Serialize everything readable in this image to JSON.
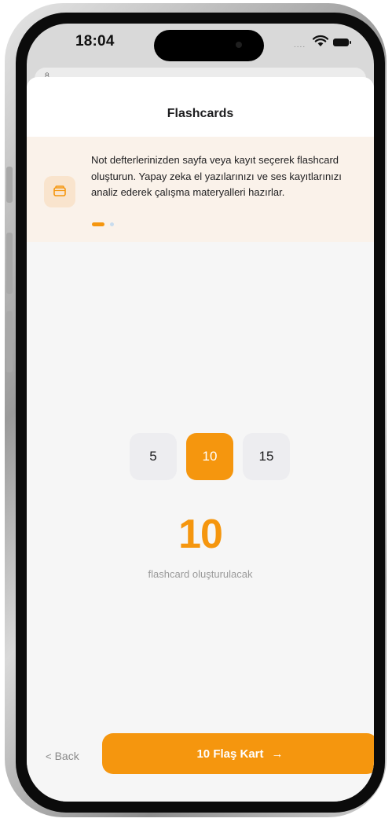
{
  "status_bar": {
    "time": "18:04",
    "signal": "...."
  },
  "sheet": {
    "title": "Flashcards",
    "back_sheet_mark": "৪"
  },
  "banner": {
    "text": "Not defterlerinizden sayfa veya kayıt seçerek flashcard oluşturun. Yapay zeka el yazılarınızı ve ses kayıtlarınızı analiz ederek çalışma materyalleri hazırlar.",
    "icon": "folder-icon",
    "pages": 2,
    "active_page": 1
  },
  "count_options": [
    {
      "label": "5",
      "selected": false
    },
    {
      "label": "10",
      "selected": true
    },
    {
      "label": "15",
      "selected": false
    }
  ],
  "selected_count": "10",
  "count_caption": "flashcard oluşturulacak",
  "footer": {
    "back_label": "Back",
    "primary_label": "10 Flaş Kart",
    "primary_arrow": "→"
  },
  "colors": {
    "accent": "#f5960e",
    "banner_bg": "#faf2ea",
    "option_bg": "#ededf0"
  }
}
